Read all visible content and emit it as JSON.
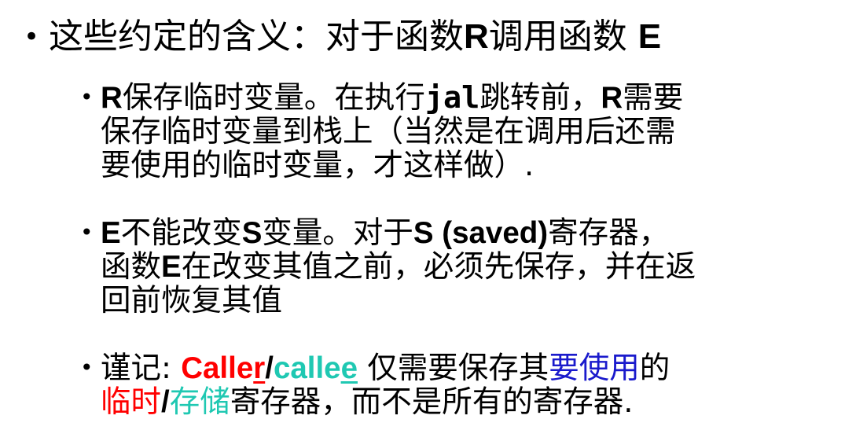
{
  "main_bullet": {
    "prefix": "这些约定的含义：对于函数",
    "caller": "R",
    "middle": "调用函数 ",
    "callee": "E"
  },
  "sub1": {
    "line1": {
      "r1": "R",
      "t1": "保存临时变量。在执行",
      "code": "jal",
      "t2": "跳转前，",
      "r2": "R",
      "t3": "需要"
    },
    "line2": "保存临时变量到栈上（当然是在调用后还需",
    "line3": "要使用的临时变量，才这样做）."
  },
  "sub2": {
    "line1": {
      "e": "E",
      "t1": "不能改变",
      "s1": "S",
      "t2": "变量。对于",
      "s2": "S (saved)",
      "t3": "寄存器，"
    },
    "line2": {
      "t1": "函数",
      "e": "E",
      "t2": "在改变其值之前，必须先保存，并在返"
    },
    "line3": "回前恢复其值"
  },
  "sub3": {
    "line1": {
      "t1": "谨记: ",
      "caller_a": "Calle",
      "caller_b": "r",
      "slash": "/",
      "callee_a": "calle",
      "callee_b": "e",
      "t2": " 仅需要保存其",
      "t3": "要使用",
      "t4": "的"
    },
    "line2": {
      "t1": "临时",
      "slash": "/",
      "t2": "存储",
      "t3": "寄存器，而不是所有的寄存器."
    }
  },
  "colors": {
    "red": "#ff0000",
    "teal": "#1fc8b2",
    "blue": "#1a1acc",
    "text": "#000000"
  }
}
